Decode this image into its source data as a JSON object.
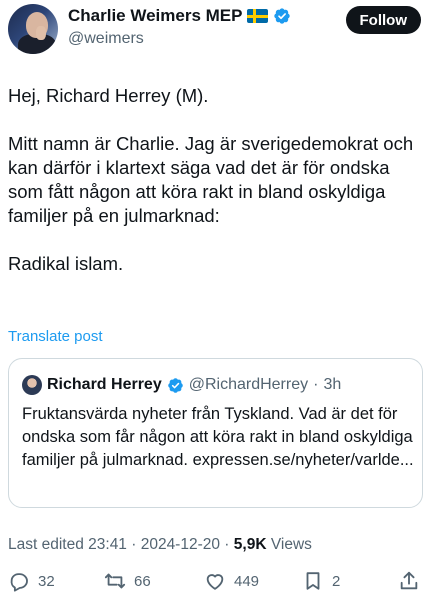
{
  "author": {
    "display_name": "Charlie Weimers MEP",
    "handle": "@weimers",
    "flag_icon": "sweden-flag-icon",
    "verified_icon": "verified-badge-icon",
    "verified_color": "#1d9bf0"
  },
  "follow_label": "Follow",
  "post": {
    "paragraphs": [
      "Hej, Richard Herrey (M).",
      "Mitt namn är Charlie. Jag är sverigedemokrat och kan därför i klartext säga vad det är för ondska som fått någon att köra rakt in bland oskyldiga familjer på en julmarknad:",
      "Radikal islam."
    ]
  },
  "translate_label": "Translate post",
  "quote": {
    "display_name": "Richard Herrey",
    "handle": "@RichardHerrey",
    "separator": "·",
    "time": "3h",
    "text": "Fruktansvärda nyheter från Tyskland.  Vad är det för ondska som får någon att köra rakt in bland oskyldiga familjer på julmarknad. expressen.se/nyheter/varlde..."
  },
  "meta": {
    "edited": "Last edited 23:41 · 2024-12-20",
    "separator": " · ",
    "views_count": "5,9K",
    "views_label": "Views"
  },
  "actions": {
    "replies": "32",
    "reposts": "66",
    "likes": "449",
    "bookmarks": "2"
  },
  "colors": {
    "text": "#0f1419",
    "secondary": "#536471",
    "accent": "#1d9bf0",
    "border": "#cfd9de"
  }
}
